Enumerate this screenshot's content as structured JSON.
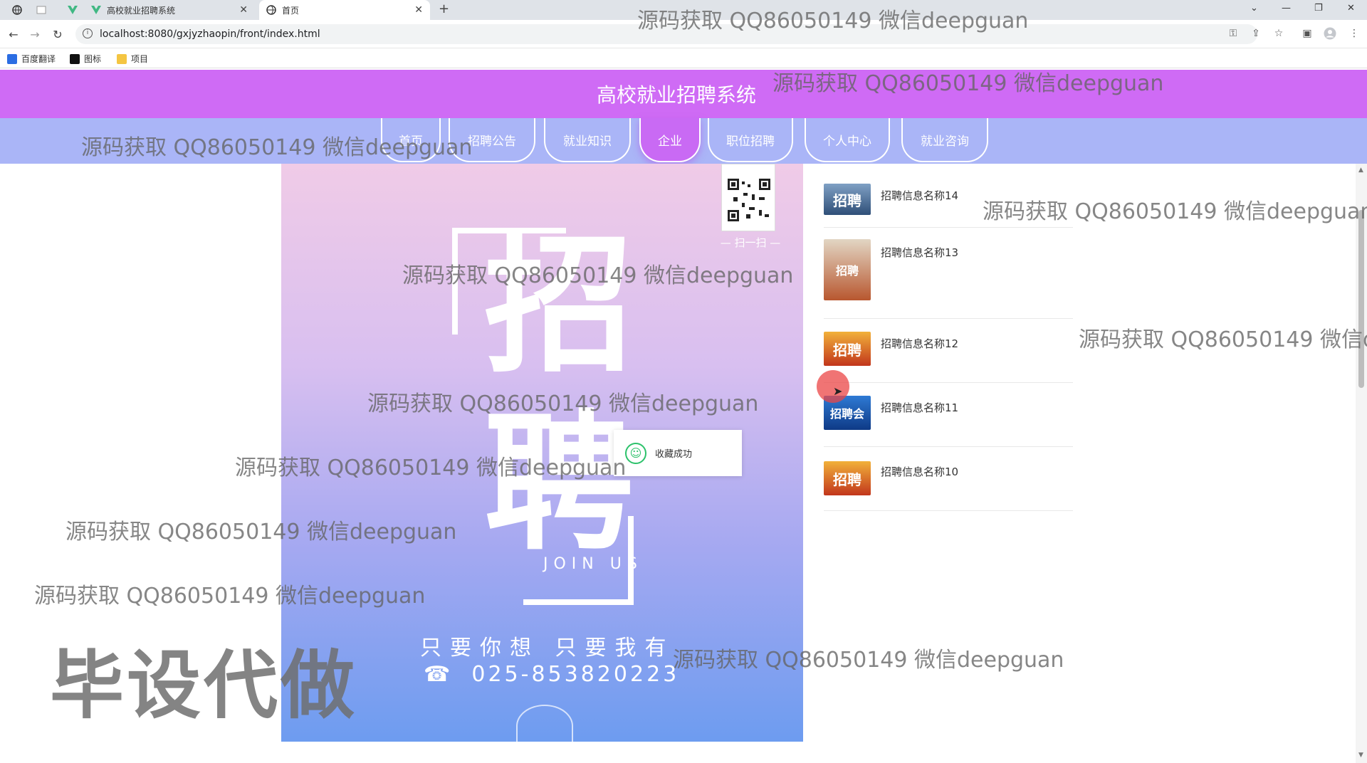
{
  "browser": {
    "tabs": [
      {
        "label": "高校就业招聘系统"
      },
      {
        "label": "首页"
      }
    ],
    "url": "localhost:8080/gxjyzhaopin/front/index.html",
    "bookmarks": [
      "百度翻译",
      "图标",
      "项目"
    ]
  },
  "site": {
    "title": "高校就业招聘系统",
    "nav": [
      {
        "label": "首页"
      },
      {
        "label": "招聘公告"
      },
      {
        "label": "就业知识"
      },
      {
        "label": "企业"
      },
      {
        "label": "职位招聘"
      },
      {
        "label": "个人中心"
      },
      {
        "label": "就业咨询"
      }
    ],
    "nav_active_index": 3
  },
  "poster": {
    "char1": "招",
    "char2": "聘",
    "joinus": "JOIN US",
    "slogan": "只要你想  只要我有",
    "phone": "025-853820223",
    "qr_caption": "— 扫一扫 —"
  },
  "news": [
    {
      "title": "招聘信息名称14",
      "thumb": "招聘"
    },
    {
      "title": "招聘信息名称13",
      "thumb": "招聘"
    },
    {
      "title": "招聘信息名称12",
      "thumb": "招聘"
    },
    {
      "title": "招聘信息名称11",
      "thumb": "招聘会"
    },
    {
      "title": "招聘信息名称10",
      "thumb": "招聘"
    }
  ],
  "toast": {
    "message": "收藏成功"
  },
  "watermark": {
    "text": "源码获取 QQ86050149 微信deepguan",
    "big": "毕设代做"
  },
  "colors": {
    "header": "#cf6bf5",
    "nav": "#aab5f7",
    "nav_active": "#c96af4",
    "toast_icon": "#2dc26b"
  }
}
